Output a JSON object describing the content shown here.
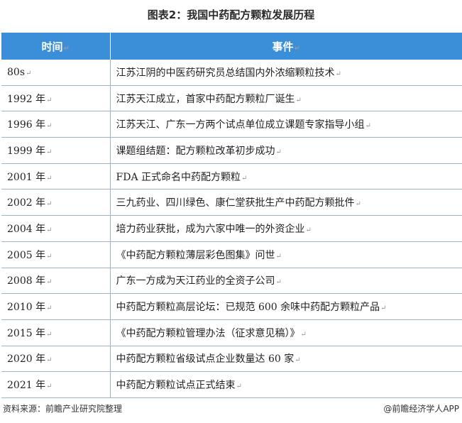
{
  "title": "图表2：我国中药配方颗粒发展历程",
  "table": {
    "headers": [
      "时间",
      "事件"
    ],
    "rows": [
      {
        "time": "80s",
        "event": "江苏江阴的中医药研究员总结国内外浓缩颗粒技术"
      },
      {
        "time": "1992 年",
        "event": "江苏天江成立，首家中药配方颗粒厂诞生"
      },
      {
        "time": "1996 年",
        "event": "江苏天江、广东一方两个试点单位成立课题专家指导小组"
      },
      {
        "time": "1999 年",
        "event": "课题组结题：配方颗粒改革初步成功"
      },
      {
        "time": "2001 年",
        "event": "FDA 正式命名中药配方颗粒"
      },
      {
        "time": "2002 年",
        "event": "三九药业、四川绿色、康仁堂获批生产中药配方颗批件"
      },
      {
        "time": "2004 年",
        "event": "培力药业获批，成为六家中唯一的外资企业"
      },
      {
        "time": "2005 年",
        "event": "《中药配方颗粒薄层彩色图集》问世"
      },
      {
        "time": "2008 年",
        "event": "广东一方成为天江药业的全资子公司"
      },
      {
        "time": "2010 年",
        "event": "中药配方颗粒高层论坛：已规范 600 余味中药配方颗粒产品"
      },
      {
        "time": "2015 年",
        "event": "《中药配方颗粒管理办法（征求意见稿）》"
      },
      {
        "time": "2020 年",
        "event": "中药配方颗粒省级试点企业数量达 60 家"
      },
      {
        "time": "2021 年",
        "event": "中药配方颗粒试点正式结束"
      }
    ],
    "mark": "↵"
  },
  "footer": {
    "source": "资料来源：前瞻产业研究院整理",
    "brand": "@前瞻经济学人APP"
  }
}
